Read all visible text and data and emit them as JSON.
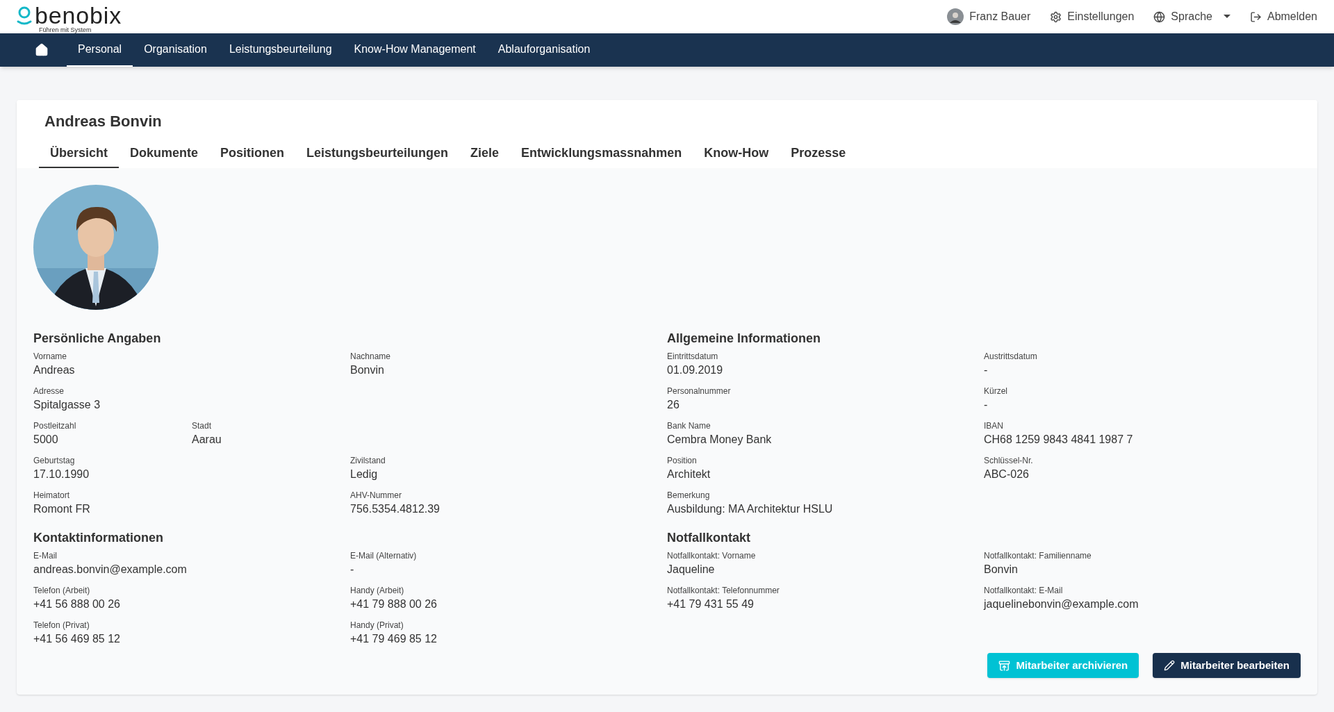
{
  "header": {
    "logo": {
      "name": "benobix",
      "tagline": "Führen mit System"
    },
    "user": "Franz Bauer",
    "settings": "Einstellungen",
    "language": "Sprache",
    "logout": "Abmelden"
  },
  "nav": [
    {
      "label": "Personal",
      "selected": true
    },
    {
      "label": "Organisation",
      "selected": false
    },
    {
      "label": "Leistungsbeurteilung",
      "selected": false
    },
    {
      "label": "Know-How Management",
      "selected": false
    },
    {
      "label": "Ablauforganisation",
      "selected": false
    }
  ],
  "employee": {
    "name": "Andreas Bonvin"
  },
  "tabs": [
    {
      "label": "Übersicht",
      "selected": true
    },
    {
      "label": "Dokumente",
      "selected": false
    },
    {
      "label": "Positionen",
      "selected": false
    },
    {
      "label": "Leistungsbeurteilungen",
      "selected": false
    },
    {
      "label": "Ziele",
      "selected": false
    },
    {
      "label": "Entwicklungsmassnahmen",
      "selected": false
    },
    {
      "label": "Know-How",
      "selected": false
    },
    {
      "label": "Prozesse",
      "selected": false
    }
  ],
  "columns": [
    {
      "sections": [
        {
          "title": "Persönliche Angaben",
          "rows": [
            {
              "fields": [
                {
                  "label": "Vorname",
                  "value": "Andreas",
                  "kind": "wide"
                },
                {
                  "label": "Nachname",
                  "value": "Bonvin",
                  "kind": "wide"
                }
              ]
            },
            {
              "fields": [
                {
                  "label": "Adresse",
                  "value": "Spitalgasse 3",
                  "kind": "wide"
                }
              ]
            },
            {
              "fields": [
                {
                  "label": "Postleitzahl",
                  "value": "5000",
                  "kind": "narrow"
                },
                {
                  "label": "Stadt",
                  "value": "Aarau",
                  "kind": "narrow"
                }
              ]
            },
            {
              "fields": [
                {
                  "label": "Geburtstag",
                  "value": "17.10.1990",
                  "kind": "wide"
                },
                {
                  "label": "Zivilstand",
                  "value": "Ledig",
                  "kind": "wide"
                }
              ]
            },
            {
              "fields": [
                {
                  "label": "Heimatort",
                  "value": "Romont FR",
                  "kind": "wide"
                },
                {
                  "label": "AHV-Nummer",
                  "value": "756.5354.4812.39",
                  "kind": "wide"
                }
              ]
            }
          ]
        },
        {
          "title": "Kontaktinformationen",
          "rows": [
            {
              "fields": [
                {
                  "label": "E-Mail",
                  "value": "andreas.bonvin@example.com",
                  "kind": "wide"
                },
                {
                  "label": "E-Mail (Alternativ)",
                  "value": "-",
                  "kind": "wide"
                }
              ]
            },
            {
              "fields": [
                {
                  "label": "Telefon (Arbeit)",
                  "value": "+41 56 888 00 26",
                  "kind": "wide"
                },
                {
                  "label": "Handy (Arbeit)",
                  "value": "+41 79 888 00 26",
                  "kind": "wide"
                }
              ]
            },
            {
              "fields": [
                {
                  "label": "Telefon (Privat)",
                  "value": "+41 56 469 85 12",
                  "kind": "wide"
                },
                {
                  "label": "Handy (Privat)",
                  "value": "+41 79 469 85 12",
                  "kind": "wide"
                }
              ]
            }
          ]
        }
      ]
    },
    {
      "sections": [
        {
          "title": "Allgemeine Informationen",
          "rows": [
            {
              "fields": [
                {
                  "label": "Eintrittsdatum",
                  "value": "01.09.2019",
                  "kind": "wide"
                },
                {
                  "label": "Austrittsdatum",
                  "value": "-",
                  "kind": "wide"
                }
              ]
            },
            {
              "fields": [
                {
                  "label": "Personalnummer",
                  "value": "26",
                  "kind": "wide"
                },
                {
                  "label": "Kürzel",
                  "value": "-",
                  "kind": "wide"
                }
              ]
            },
            {
              "fields": [
                {
                  "label": "Bank Name",
                  "value": "Cembra Money Bank",
                  "kind": "wide"
                },
                {
                  "label": "IBAN",
                  "value": "CH68 1259 9843 4841 1987 7",
                  "kind": "wide"
                }
              ]
            },
            {
              "fields": [
                {
                  "label": "Position",
                  "value": "Architekt",
                  "kind": "wide"
                },
                {
                  "label": "Schlüssel-Nr.",
                  "value": "ABC-026",
                  "kind": "wide"
                }
              ]
            },
            {
              "fields": [
                {
                  "label": "Bemerkung",
                  "value": "Ausbildung: MA Architektur HSLU",
                  "kind": "wide"
                }
              ]
            }
          ]
        },
        {
          "title": "Notfallkontakt",
          "rows": [
            {
              "fields": [
                {
                  "label": "Notfallkontakt: Vorname",
                  "value": "Jaqueline",
                  "kind": "wide"
                },
                {
                  "label": "Notfallkontakt: Familienname",
                  "value": "Bonvin",
                  "kind": "wide"
                }
              ]
            },
            {
              "fields": [
                {
                  "label": "Notfallkontakt: Telefonnummer",
                  "value": "+41 79 431 55 49",
                  "kind": "wide"
                },
                {
                  "label": "Notfallkontakt: E-Mail",
                  "value": "jaquelinebonvin@example.com",
                  "kind": "wide"
                }
              ]
            }
          ]
        }
      ]
    }
  ],
  "actions": [
    {
      "label": "Mitarbeiter archivieren",
      "kind": "archive"
    },
    {
      "label": "Mitarbeiter bearbeiten",
      "kind": "edit"
    }
  ]
}
